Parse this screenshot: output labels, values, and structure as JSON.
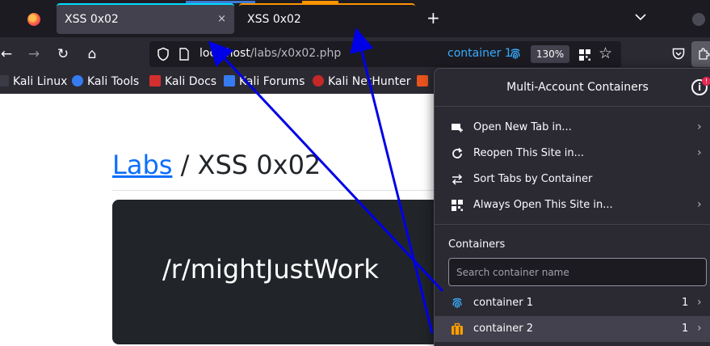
{
  "tabs": [
    {
      "title": "XSS 0x02",
      "close": "×"
    },
    {
      "title": "XSS 0x02"
    }
  ],
  "new_tab_glyph": "+",
  "nav": {
    "back": "←",
    "forward": "→",
    "reload": "↻",
    "home": "⌂"
  },
  "url": {
    "host": "localhost",
    "path": "/labs/x0x02.php",
    "container": "container 1",
    "zoom": "130%",
    "star": "☆"
  },
  "bookmarks": [
    "Kali Linux",
    "Kali Tools",
    "Kali Docs",
    "Kali Forums",
    "Kali NetHunter"
  ],
  "page": {
    "breadcrumb_link": "Labs",
    "breadcrumb_rest": " / XSS 0x02",
    "card_text": "/r/mightJustWork"
  },
  "panel": {
    "title": "Multi-Account Containers",
    "info": "i",
    "badge": "!",
    "menu": [
      {
        "label": "Open New Tab in...",
        "icon": "new-tab-icon"
      },
      {
        "label": "Reopen This Site in...",
        "icon": "reopen-icon"
      },
      {
        "label": "Sort Tabs by Container",
        "icon": "sort-icon"
      },
      {
        "label": "Always Open This Site in...",
        "icon": "always-open-icon"
      }
    ],
    "containers_label": "Containers",
    "search_placeholder": "Search container name",
    "containers": [
      {
        "name": "container 1",
        "count": "1",
        "color": "#37adff",
        "icon": "fingerprint-icon"
      },
      {
        "name": "container 2",
        "count": "1",
        "color": "#ff9f00",
        "icon": "briefcase-icon"
      }
    ],
    "chevron": "›"
  },
  "colors": {
    "accent_blue": "#0d6efd",
    "container_blue": "#37adff",
    "container_orange": "#ff9f00",
    "annotation_arrow": "#0000e6"
  }
}
